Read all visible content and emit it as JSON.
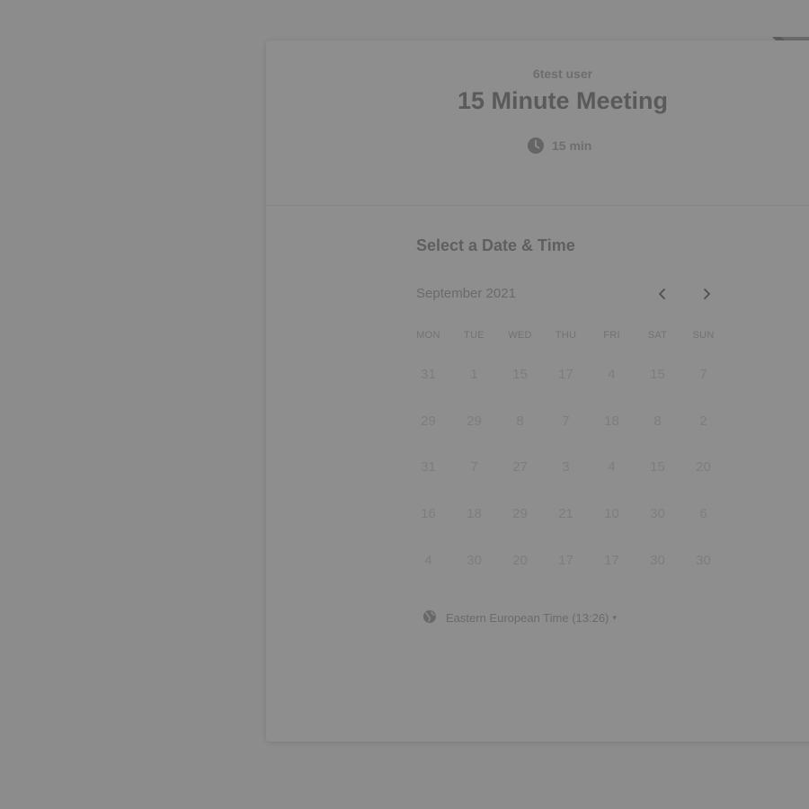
{
  "event": {
    "owner": "6test user",
    "title": "15 Minute Meeting",
    "duration": "15 min",
    "duration_icon": "clock-icon"
  },
  "scheduler": {
    "heading": "Select a Date & Time",
    "month_label": "September 2021",
    "prev_icon": "chevron-left-icon",
    "next_icon": "chevron-right-icon",
    "weekdays": [
      "MON",
      "TUE",
      "WED",
      "THU",
      "FRI",
      "SAT",
      "SUN"
    ],
    "weeks": [
      [
        "31",
        "1",
        "15",
        "17",
        "4",
        "15",
        "7"
      ],
      [
        "29",
        "29",
        "8",
        "7",
        "18",
        "8",
        "2"
      ],
      [
        "31",
        "7",
        "27",
        "3",
        "4",
        "15",
        "20"
      ],
      [
        "16",
        "18",
        "29",
        "21",
        "10",
        "30",
        "6"
      ],
      [
        "4",
        "30",
        "20",
        "17",
        "17",
        "30",
        "30"
      ]
    ]
  },
  "timezone": {
    "icon": "globe-icon",
    "label": "Eastern European Time (13:26)",
    "caret": "▾"
  },
  "colors": {
    "overlay": "#8c8c8c",
    "card": "#8e8e8e"
  }
}
